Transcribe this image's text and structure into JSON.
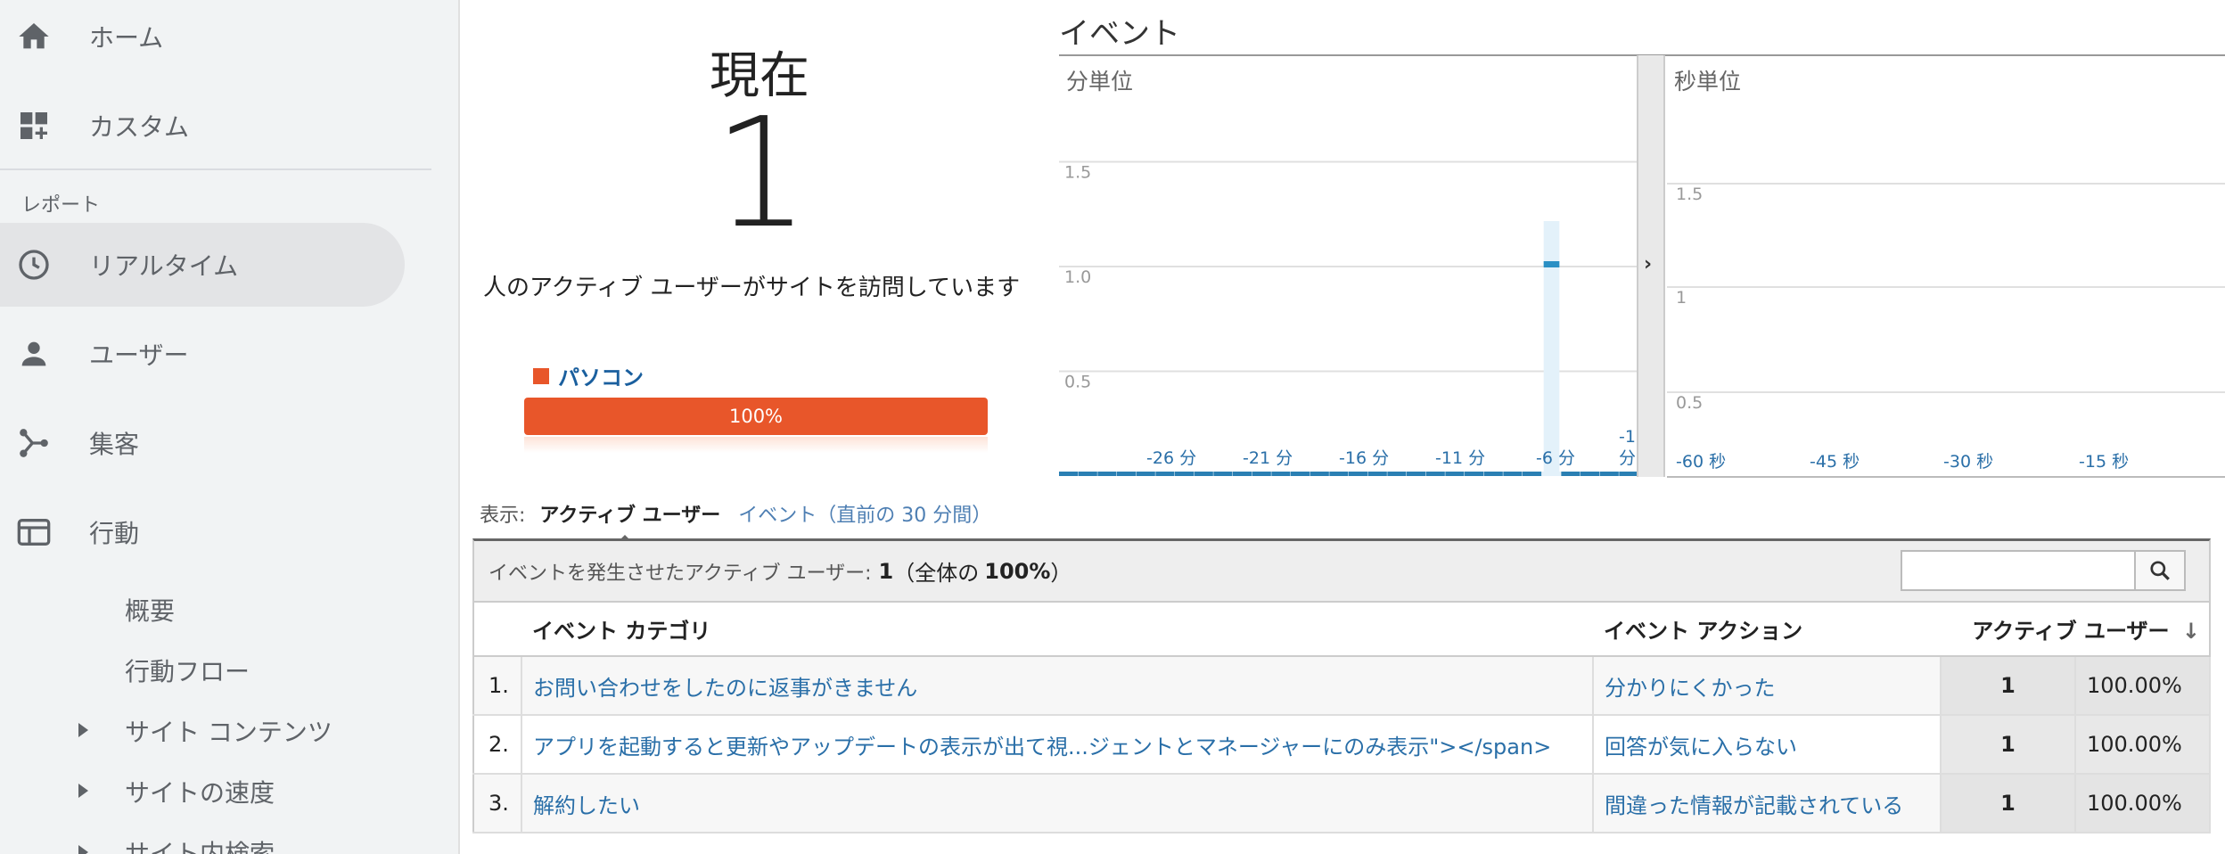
{
  "sidebar": {
    "items": [
      {
        "label": "ホーム",
        "icon": "home-icon"
      },
      {
        "label": "カスタム",
        "icon": "dashboard-add-icon"
      }
    ],
    "section_label": "レポート",
    "report_items": [
      {
        "label": "リアルタイム",
        "icon": "clock-icon",
        "active": true
      },
      {
        "label": "ユーザー",
        "icon": "person-icon"
      },
      {
        "label": "集客",
        "icon": "acquisition-icon"
      },
      {
        "label": "行動",
        "icon": "behavior-icon"
      }
    ],
    "behavior_sub": [
      "概要",
      "行動フロー",
      "サイト コンテンツ",
      "サイトの速度",
      "サイト内検索"
    ]
  },
  "realtime": {
    "now_title": "現在",
    "active_count": "1",
    "description": "人のアクティブ ユーザーがサイトを訪問しています",
    "device": {
      "name": "パソコン",
      "percent_label": "100%",
      "percent": 100,
      "color": "#e8562a"
    }
  },
  "chart_data": [
    {
      "type": "bar",
      "title": "イベント",
      "subtitle": "分単位",
      "x_tick_labels": [
        "-26 分",
        "-21 分",
        "-16 分",
        "-11 分",
        "-6 分",
        "-1 分"
      ],
      "y_tick_labels": [
        "0.5",
        "1.0",
        "1.5"
      ],
      "ylim": [
        0,
        2
      ],
      "x": [
        -30,
        -29,
        -28,
        -27,
        -26,
        -25,
        -24,
        -23,
        -22,
        -21,
        -20,
        -19,
        -18,
        -17,
        -16,
        -15,
        -14,
        -13,
        -12,
        -11,
        -10,
        -9,
        -8,
        -7,
        -6,
        -5,
        -4,
        -3,
        -2,
        -1
      ],
      "values": [
        0,
        0,
        0,
        0,
        0,
        0,
        0,
        0,
        0,
        0,
        0,
        0,
        0,
        0,
        0,
        0,
        0,
        0,
        0,
        0,
        0,
        0,
        0,
        0,
        0,
        1,
        0,
        0,
        0,
        0
      ],
      "highlight_index": 25,
      "color": "#2a8fc4"
    },
    {
      "type": "bar",
      "subtitle": "秒単位",
      "x_tick_labels": [
        "-60 秒",
        "-45 秒",
        "-30 秒",
        "-15 秒"
      ],
      "y_tick_labels": [
        "0.5",
        "1",
        "1.5"
      ],
      "ylim": [
        0,
        2
      ],
      "values": []
    }
  ],
  "view": {
    "label": "表示:",
    "tab_active": "アクティブ ユーザー",
    "tab_other": "イベント（直前の 30 分間）"
  },
  "summary": {
    "prefix": "イベントを発生させたアクティブ ユーザー:",
    "count": "1",
    "middle": "（全体の",
    "percent": "100%",
    "suffix": "）"
  },
  "table": {
    "headers": {
      "category": "イベント カテゴリ",
      "action": "イベント アクション",
      "users": "アクティブ ユーザー"
    },
    "rows": [
      {
        "idx": "1.",
        "category": "お問い合わせをしたのに返事がきません",
        "action": "分かりにくかった",
        "users": "1",
        "pct": "100.00%"
      },
      {
        "idx": "2.",
        "category": "アプリを起動すると更新やアップデートの表示が出て視...ジェントとマネージャーにのみ表示\"></span>",
        "action": "回答が気に入らない",
        "users": "1",
        "pct": "100.00%"
      },
      {
        "idx": "3.",
        "category": "解約したい",
        "action": "間違った情報が記載されている",
        "users": "1",
        "pct": "100.00%"
      }
    ]
  }
}
